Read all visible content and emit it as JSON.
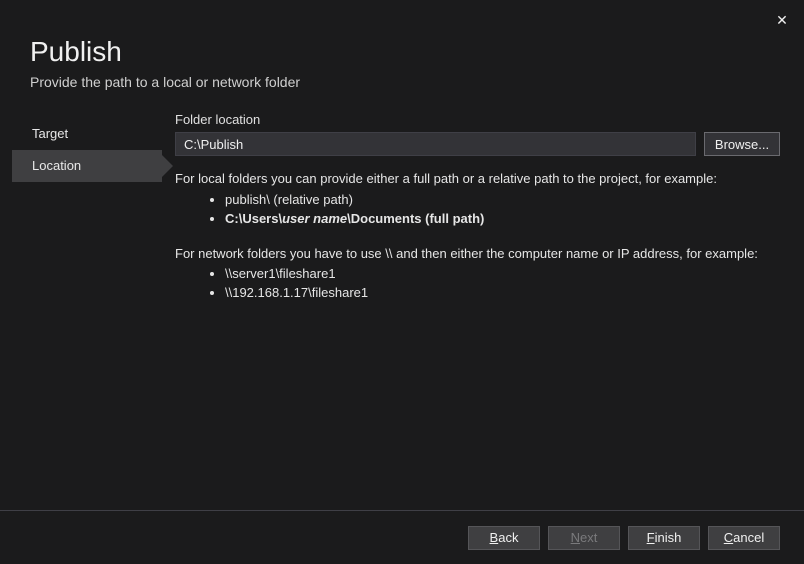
{
  "close_glyph": "✕",
  "header": {
    "title": "Publish",
    "subtitle": "Provide the path to a local or network folder"
  },
  "sidebar": {
    "steps": [
      {
        "label": "Target"
      },
      {
        "label": "Location"
      }
    ]
  },
  "content": {
    "field_label": "Folder location",
    "path_value": "C:\\Publish",
    "browse_label": "Browse...",
    "help_local_intro": "For local folders you can provide either a full path or a relative path to the project, for example:",
    "help_local_ex1": "publish\\ (relative path)",
    "help_local_ex2_prefix": "C:\\Users\\",
    "help_local_ex2_mid": "user name",
    "help_local_ex2_suffix": "\\Documents (full path)",
    "help_net_intro": "For network folders you have to use \\\\ and then either the computer name or IP address, for example:",
    "help_net_ex1": "\\\\server1\\fileshare1",
    "help_net_ex2": "\\\\192.168.1.17\\fileshare1"
  },
  "footer": {
    "back": "Back",
    "next": "Next",
    "finish": "Finish",
    "cancel": "Cancel",
    "mnemonics": {
      "back": "B",
      "next": "N",
      "finish": "F",
      "cancel": "C"
    }
  }
}
